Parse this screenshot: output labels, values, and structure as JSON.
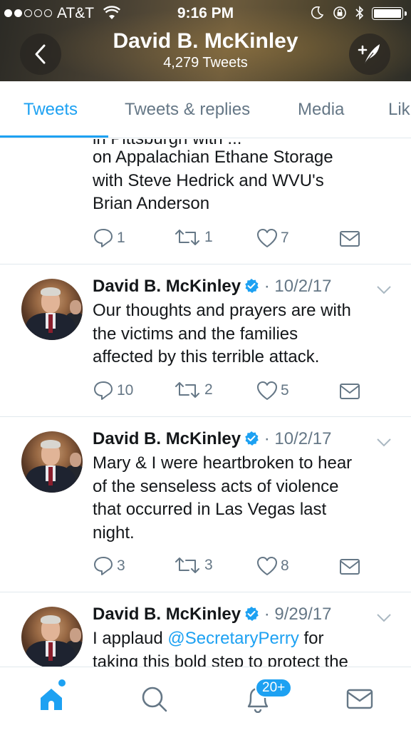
{
  "status_bar": {
    "carrier": "AT&T",
    "time": "9:16 PM"
  },
  "header": {
    "name": "David B. McKinley",
    "tweet_count": "4,279 Tweets"
  },
  "tabs": [
    {
      "label": "Tweets",
      "active": true
    },
    {
      "label": "Tweets & replies",
      "active": false
    },
    {
      "label": "Media",
      "active": false
    },
    {
      "label": "Lik",
      "active": false
    }
  ],
  "tweets": [
    {
      "partial_top_text": "in Pittsburgh with ...",
      "lines": [
        "on Appalachian Ethane Storage",
        "with Steve Hedrick and WVU's",
        "Brian Anderson"
      ],
      "replies": "1",
      "retweets": "1",
      "likes": "7"
    },
    {
      "author": "David B. McKinley",
      "date": "· 10/2/17",
      "lines": [
        "Our thoughts and prayers are with",
        "the victims and the families",
        "affected by this terrible attack."
      ],
      "replies": "10",
      "retweets": "2",
      "likes": "5"
    },
    {
      "author": "David B. McKinley",
      "date": "· 10/2/17",
      "lines": [
        "Mary & I were heartbroken to hear",
        "of the senseless acts of violence",
        "that occurred in Las Vegas last",
        "night."
      ],
      "replies": "3",
      "retweets": "3",
      "likes": "8"
    },
    {
      "author": "David B. McKinley",
      "date": "· 9/29/17",
      "line1_prefix": "I applaud ",
      "mention": "@SecretaryPerry",
      "line1_suffix": " for",
      "line2": "taking this bold step to protect the"
    }
  ],
  "bottom_bar": {
    "notifications_badge": "20+"
  },
  "colors": {
    "accent": "#1da1f2",
    "text": "#14171a",
    "muted": "#657786",
    "divider": "#e1e8ed"
  },
  "icons": [
    "back-chevron-icon",
    "compose-feather-icon",
    "verified-badge-icon",
    "reply-icon",
    "retweet-icon",
    "like-heart-icon",
    "direct-message-icon",
    "home-icon",
    "search-icon",
    "notifications-bell-icon",
    "messages-envelope-icon"
  ]
}
